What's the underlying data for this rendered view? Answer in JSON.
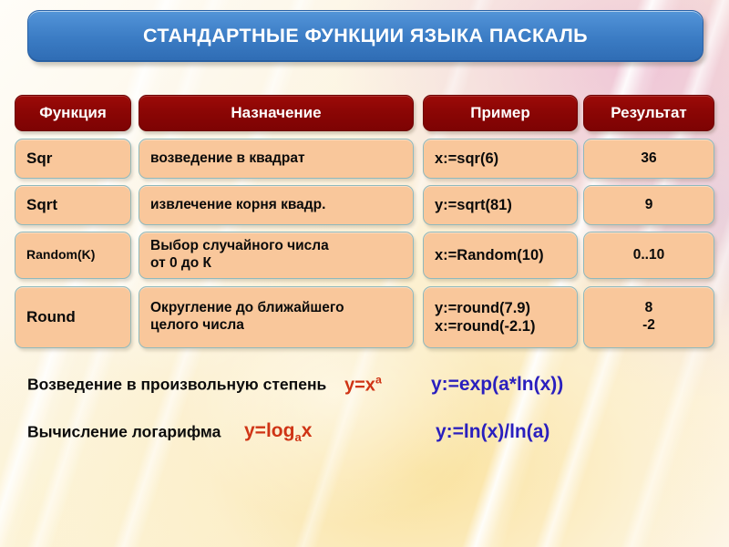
{
  "slide": {
    "title": "СТАНДАРТНЫЕ ФУНКЦИИ ЯЗЫКА ПАСКАЛЬ",
    "colors": {
      "title_blue": "#3b7cc4",
      "header_red": "#8d0605",
      "cell_peach": "#f9c79b",
      "cell_border": "#8fb9bd",
      "formula_red": "#cf3415",
      "formula_blue": "#2a1fbe",
      "text_black": "#0a0a0a"
    }
  },
  "table": {
    "headers": [
      {
        "label": "Функция"
      },
      {
        "label": "Назначение"
      },
      {
        "label": "Пример"
      },
      {
        "label": "Результат"
      }
    ],
    "rows": [
      {
        "function": "Sqr",
        "description": "возведение в квадрат",
        "example": "x:=sqr(6)",
        "result": "36"
      },
      {
        "function": "Sqrt",
        "description": "извлечение корня квадр.",
        "example": "y:=sqrt(81)",
        "result": "9"
      },
      {
        "function": "Random(K)",
        "description_line1": "Выбор случайного числа",
        "description_line2": " от 0 до К",
        "example": "x:=Random(10)",
        "result": "0..10"
      },
      {
        "function": "Round",
        "description_line1": "Округление до ближайшего",
        "description_line2": "целого числа",
        "example_line1": "y:=round(7.9)",
        "example_line2": "x:=round(-2.1)",
        "result_line1": "8",
        "result_line2": "-2"
      }
    ]
  },
  "formulas": [
    {
      "label": "Возведение в произвольную степень",
      "math_base": "y=x",
      "math_sup": "a",
      "pascal": "y:=exp(a*ln(x))"
    },
    {
      "label": "Вычисление логарифма",
      "math_pre": "y=log",
      "math_sub": "a",
      "math_post": "x",
      "pascal": "y:=ln(x)/ln(a)"
    }
  ]
}
